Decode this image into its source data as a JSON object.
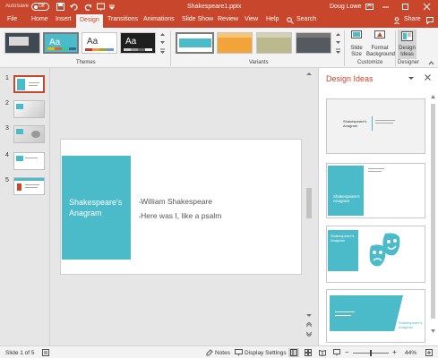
{
  "titlebar": {
    "autosave_label": "AutoSave",
    "autosave_state": "Off",
    "document_title": "Shakespeare1.pptx",
    "user_name": "Doug Lowe"
  },
  "ribbon_tabs": [
    "File",
    "Home",
    "Insert",
    "Design",
    "Transitions",
    "Animations",
    "Slide Show",
    "Review",
    "View",
    "Help"
  ],
  "active_tab": "Design",
  "search_label": "Search",
  "share_label": "Share",
  "ribbon": {
    "themes_theme_text": [
      "Aa",
      "Aa",
      "Aa"
    ],
    "themes_label": "Themes",
    "variants_label": "Variants",
    "slide_size_label": "Slide Size",
    "format_background_label": "Format Background",
    "customize_label": "Customize",
    "design_ideas_label": "Design Ideas",
    "designer_label": "Designer"
  },
  "slides": [
    {
      "number": "1"
    },
    {
      "number": "2"
    },
    {
      "number": "3"
    },
    {
      "number": "4"
    },
    {
      "number": "5"
    }
  ],
  "main_slide": {
    "title": "Shakespeare's Anagram",
    "bullets": [
      "William Shakespeare",
      "Here was I, like a psalm"
    ]
  },
  "design_pane": {
    "title": "Design Ideas",
    "ideas": [
      {
        "title": "Shakespeare's Anagram"
      },
      {
        "title": "Shakespeare's Anagram"
      },
      {
        "title": "Shakespeare's Anagram"
      },
      {
        "title": "Shakespeare's Anagram"
      }
    ]
  },
  "status": {
    "slide_count": "Slide 1 of 5",
    "notes_label": "Notes",
    "display_settings_label": "Display Settings",
    "zoom": "44%"
  },
  "colors": {
    "accent": "#c8462b",
    "teal": "#4bbac9"
  }
}
